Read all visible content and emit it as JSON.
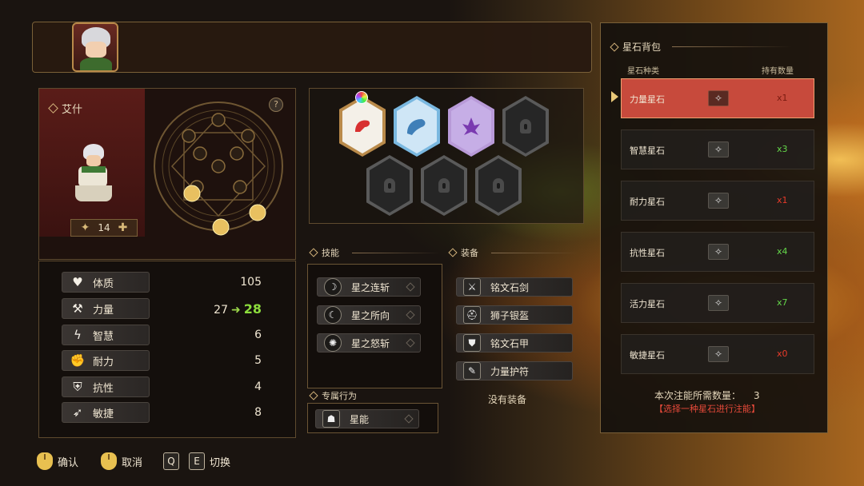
{
  "character": {
    "name": "艾什",
    "level": "14",
    "help_label": "?"
  },
  "stats_header": {},
  "stats": [
    {
      "label": "体质",
      "icon": "heart-icon",
      "glyph": "♥",
      "value": "105"
    },
    {
      "label": "力量",
      "icon": "axe-icon",
      "glyph": "⚒",
      "old_value": "27",
      "new_value": "28"
    },
    {
      "label": "智慧",
      "icon": "lightning-icon",
      "glyph": "ϟ",
      "value": "6"
    },
    {
      "label": "耐力",
      "icon": "fist-icon",
      "glyph": "✊",
      "value": "5"
    },
    {
      "label": "抗性",
      "icon": "shield-icon",
      "glyph": "⛨",
      "value": "4"
    },
    {
      "label": "敏捷",
      "icon": "wing-icon",
      "glyph": "➶",
      "value": "8"
    }
  ],
  "skills": {
    "title": "技能",
    "items": [
      {
        "label": "星之连斩",
        "icon": "slash-icon",
        "glyph": "☽"
      },
      {
        "label": "星之所向",
        "icon": "crescent-icon",
        "glyph": "☾"
      },
      {
        "label": "星之怒斩",
        "icon": "burst-icon",
        "glyph": "✺"
      }
    ]
  },
  "equipment": {
    "title": "装备",
    "items": [
      {
        "label": "铭文石剑",
        "icon": "sword-icon",
        "glyph": "⚔"
      },
      {
        "label": "狮子银盔",
        "icon": "helmet-icon",
        "glyph": "⛑"
      },
      {
        "label": "铭文石甲",
        "icon": "armor-icon",
        "glyph": "⛊"
      },
      {
        "label": "力量护符",
        "icon": "amulet-icon",
        "glyph": "✎"
      }
    ],
    "empty_label": "没有装备"
  },
  "exclusive": {
    "title": "专属行为",
    "item": {
      "label": "星能",
      "icon": "star-energy-icon",
      "glyph": "☗"
    }
  },
  "star_bag": {
    "title": "星石背包",
    "col_type": "星石种类",
    "col_count": "持有数量",
    "rows": [
      {
        "name": "力量星石",
        "count": "x1",
        "count_color": "dark",
        "selected": true
      },
      {
        "name": "智慧星石",
        "count": "x3",
        "count_color": "green",
        "selected": false
      },
      {
        "name": "耐力星石",
        "count": "x1",
        "count_color": "red",
        "selected": false
      },
      {
        "name": "抗性星石",
        "count": "x4",
        "count_color": "green",
        "selected": false
      },
      {
        "name": "活力星石",
        "count": "x7",
        "count_color": "green",
        "selected": false
      },
      {
        "name": "敏捷星石",
        "count": "x0",
        "count_color": "red",
        "selected": false
      }
    ],
    "need_label": "本次注能所需数量：",
    "need_value": "3",
    "hint": "【选择一种星石进行注能】"
  },
  "controls": {
    "confirm": "确认",
    "cancel": "取消",
    "key_q": "Q",
    "key_e": "E",
    "switch": "切换"
  }
}
